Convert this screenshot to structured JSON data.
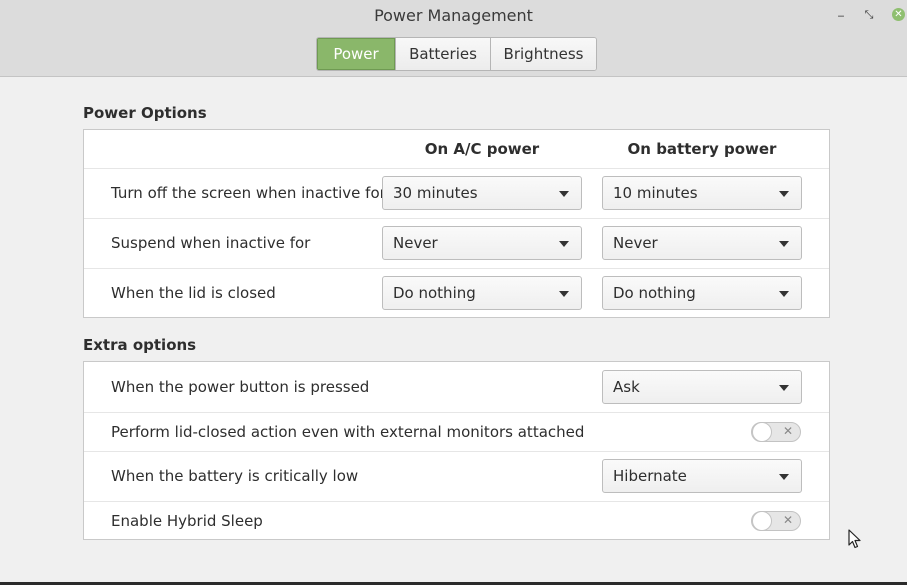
{
  "window": {
    "title": "Power Management",
    "controls": {
      "minimize": "‒",
      "maximize": "⤡",
      "close": "✕"
    }
  },
  "tabs": [
    {
      "label": "Power",
      "active": true
    },
    {
      "label": "Batteries",
      "active": false
    },
    {
      "label": "Brightness",
      "active": false
    }
  ],
  "power_options": {
    "title": "Power Options",
    "col_ac": "On A/C power",
    "col_battery": "On battery power",
    "rows": [
      {
        "label": "Turn off the screen when inactive for",
        "ac": "30 minutes",
        "battery": "10 minutes"
      },
      {
        "label": "Suspend when inactive for",
        "ac": "Never",
        "battery": "Never"
      },
      {
        "label": "When the lid is closed",
        "ac": "Do nothing",
        "battery": "Do nothing"
      }
    ]
  },
  "extra_options": {
    "title": "Extra options",
    "power_button": {
      "label": "When the power button is pressed",
      "value": "Ask"
    },
    "lid_external": {
      "label": "Perform lid-closed action even with external monitors attached",
      "enabled": false,
      "off_glyph": "✕"
    },
    "battery_critical": {
      "label": "When the battery is critically low",
      "value": "Hibernate"
    },
    "hybrid_sleep": {
      "label": "Enable Hybrid Sleep",
      "enabled": false,
      "off_glyph": "✕"
    }
  },
  "colors": {
    "accent": "#8ab76a",
    "header": "#dcdcdc"
  }
}
